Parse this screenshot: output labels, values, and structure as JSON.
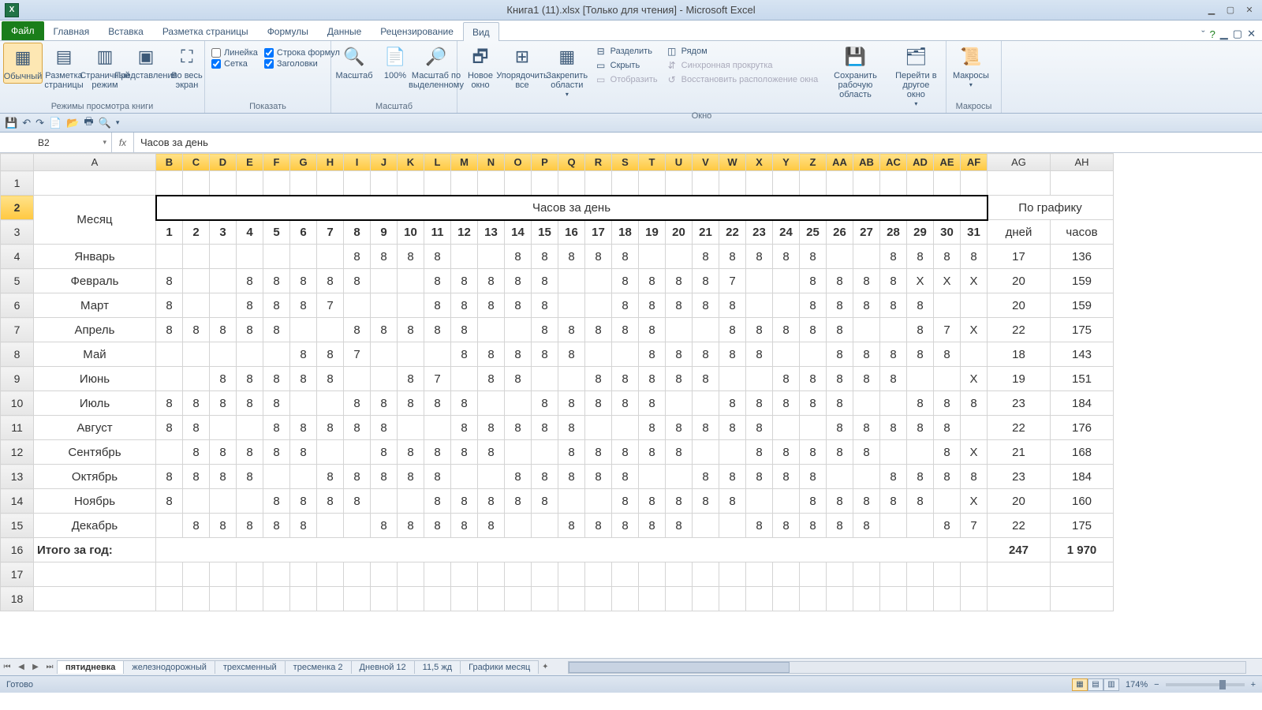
{
  "title": "Книга1 (11).xlsx  [Только для чтения]  -  Microsoft Excel",
  "tabs": {
    "file": "Файл",
    "list": [
      "Главная",
      "Вставка",
      "Разметка страницы",
      "Формулы",
      "Данные",
      "Рецензирование",
      "Вид"
    ],
    "active": 6
  },
  "ribbon": {
    "g1": {
      "label": "Режимы просмотра книги",
      "b": [
        "Обычный",
        "Разметка страницы",
        "Страничный режим",
        "Представления",
        "Во весь экран"
      ]
    },
    "g2": {
      "label": "Показать",
      "c": [
        [
          "Линейка",
          false
        ],
        [
          "Строка формул",
          true
        ],
        [
          "Сетка",
          true
        ],
        [
          "Заголовки",
          true
        ]
      ]
    },
    "g3": {
      "label": "Масштаб",
      "b": [
        "Масштаб",
        "100%",
        "Масштаб по выделенному"
      ]
    },
    "g4": {
      "label": "Окно",
      "b": [
        "Новое окно",
        "Упорядочить все",
        "Закрепить области"
      ],
      "s": [
        "Разделить",
        "Скрыть",
        "Отобразить",
        "Рядом",
        "Синхронная прокрутка",
        "Восстановить расположение окна"
      ],
      "b2": [
        "Сохранить рабочую область",
        "Перейти в другое окно"
      ]
    },
    "g5": {
      "label": "Макросы",
      "b": [
        "Макросы"
      ]
    }
  },
  "namebox": "B2",
  "formula": "Часов за день",
  "cols": [
    "",
    "A",
    "B",
    "C",
    "D",
    "E",
    "F",
    "G",
    "H",
    "I",
    "J",
    "K",
    "L",
    "M",
    "N",
    "O",
    "P",
    "Q",
    "R",
    "S",
    "T",
    "U",
    "V",
    "W",
    "X",
    "Y",
    "Z",
    "AA",
    "AB",
    "AC",
    "AD",
    "AE",
    "AF",
    "AG",
    "AH"
  ],
  "r2": {
    "month": "Месяц",
    "hours": "Часов за день",
    "sched": "По графику"
  },
  "r3": {
    "days": [
      "1",
      "2",
      "3",
      "4",
      "5",
      "6",
      "7",
      "8",
      "9",
      "10",
      "11",
      "12",
      "13",
      "14",
      "15",
      "16",
      "17",
      "18",
      "19",
      "20",
      "21",
      "22",
      "23",
      "24",
      "25",
      "26",
      "27",
      "28",
      "29",
      "30",
      "31"
    ],
    "d": "дней",
    "h": "часов"
  },
  "months": [
    {
      "n": "Январь",
      "v": [
        "",
        "",
        "",
        "",
        "",
        "",
        "",
        "8",
        "8",
        "8",
        "8",
        "",
        "",
        "8",
        "8",
        "8",
        "8",
        "8",
        "",
        "",
        "8",
        "8",
        "8",
        "8",
        "8",
        "",
        "",
        "8",
        "8",
        "8",
        "8"
      ],
      "y": [
        1,
        2,
        3,
        4,
        5,
        6,
        7,
        12,
        13,
        19,
        20,
        26,
        27
      ],
      "d": "17",
      "h": "136"
    },
    {
      "n": "Февраль",
      "v": [
        "8",
        "",
        "",
        "8",
        "8",
        "8",
        "8",
        "8",
        "",
        "",
        "8",
        "8",
        "8",
        "8",
        "8",
        "",
        "",
        "8",
        "8",
        "8",
        "8",
        "7",
        "",
        "",
        "8",
        "8",
        "8",
        "8",
        "Х",
        "Х",
        "Х"
      ],
      "y": [
        2,
        3,
        9,
        10,
        16,
        17,
        23,
        24
      ],
      "g": [
        29,
        30,
        31
      ],
      "d": "20",
      "h": "159"
    },
    {
      "n": "Март",
      "v": [
        "8",
        "",
        "",
        "8",
        "8",
        "8",
        "7",
        "",
        "",
        "",
        "8",
        "8",
        "8",
        "8",
        "8",
        "",
        "",
        "8",
        "8",
        "8",
        "8",
        "8",
        "",
        "",
        "8",
        "8",
        "8",
        "8",
        "8",
        "",
        ""
      ],
      "y": [
        2,
        3,
        8,
        9,
        10,
        16,
        17,
        23,
        24,
        30,
        31
      ],
      "d": "20",
      "h": "159"
    },
    {
      "n": "Апрель",
      "v": [
        "8",
        "8",
        "8",
        "8",
        "8",
        "",
        "",
        "8",
        "8",
        "8",
        "8",
        "8",
        "",
        "",
        "8",
        "8",
        "8",
        "8",
        "8",
        "",
        "",
        "8",
        "8",
        "8",
        "8",
        "8",
        "",
        "",
        "8",
        "7",
        "Х"
      ],
      "y": [
        6,
        7,
        13,
        14,
        20,
        21,
        27,
        28
      ],
      "g": [
        31
      ],
      "d": "22",
      "h": "175"
    },
    {
      "n": "Май",
      "v": [
        "",
        "",
        "",
        "",
        "",
        "8",
        "8",
        "7",
        "",
        "",
        "",
        "8",
        "8",
        "8",
        "8",
        "8",
        "",
        "",
        "8",
        "8",
        "8",
        "8",
        "8",
        "",
        "",
        "8",
        "8",
        "8",
        "8",
        "8",
        ""
      ],
      "y": [
        1,
        2,
        3,
        4,
        5,
        9,
        10,
        11,
        17,
        18,
        24,
        25,
        31
      ],
      "d": "18",
      "h": "143"
    },
    {
      "n": "Июнь",
      "v": [
        "",
        "",
        "8",
        "8",
        "8",
        "8",
        "8",
        "",
        "",
        "8",
        "7",
        "",
        "8",
        "8",
        "",
        "",
        "8",
        "8",
        "8",
        "8",
        "8",
        "",
        "",
        "8",
        "8",
        "8",
        "8",
        "8",
        "",
        "",
        "Х"
      ],
      "y": [
        1,
        2,
        8,
        9,
        12,
        15,
        16,
        22,
        23,
        29,
        30
      ],
      "g": [
        31
      ],
      "d": "19",
      "h": "151"
    },
    {
      "n": "Июль",
      "v": [
        "8",
        "8",
        "8",
        "8",
        "8",
        "",
        "",
        "8",
        "8",
        "8",
        "8",
        "8",
        "",
        "",
        "8",
        "8",
        "8",
        "8",
        "8",
        "",
        "",
        "8",
        "8",
        "8",
        "8",
        "8",
        "",
        "",
        "8",
        "8",
        "8"
      ],
      "y": [
        6,
        7,
        13,
        14,
        20,
        21,
        27,
        28
      ],
      "d": "23",
      "h": "184"
    },
    {
      "n": "Август",
      "v": [
        "8",
        "8",
        "",
        "",
        "8",
        "8",
        "8",
        "8",
        "8",
        "",
        "",
        "8",
        "8",
        "8",
        "8",
        "8",
        "",
        "",
        "8",
        "8",
        "8",
        "8",
        "8",
        "",
        "",
        "8",
        "8",
        "8",
        "8",
        "8",
        ""
      ],
      "y": [
        3,
        4,
        10,
        11,
        17,
        18,
        24,
        25,
        31
      ],
      "d": "22",
      "h": "176"
    },
    {
      "n": "Сентябрь",
      "v": [
        "",
        "8",
        "8",
        "8",
        "8",
        "8",
        "",
        "",
        "8",
        "8",
        "8",
        "8",
        "8",
        "",
        "",
        "8",
        "8",
        "8",
        "8",
        "8",
        "",
        "",
        "8",
        "8",
        "8",
        "8",
        "8",
        "",
        "",
        "8",
        "Х"
      ],
      "y": [
        1,
        7,
        8,
        14,
        15,
        21,
        22,
        28,
        29
      ],
      "g": [
        31
      ],
      "d": "21",
      "h": "168"
    },
    {
      "n": "Октябрь",
      "v": [
        "8",
        "8",
        "8",
        "8",
        "",
        "",
        "8",
        "8",
        "8",
        "8",
        "8",
        "",
        "",
        "8",
        "8",
        "8",
        "8",
        "8",
        "",
        "",
        "8",
        "8",
        "8",
        "8",
        "8",
        "",
        "",
        "8",
        "8",
        "8",
        "8"
      ],
      "y": [
        5,
        6,
        12,
        13,
        19,
        20,
        26,
        27
      ],
      "d": "23",
      "h": "184"
    },
    {
      "n": "Ноябрь",
      "v": [
        "8",
        "",
        "",
        "",
        "8",
        "8",
        "8",
        "8",
        "",
        "",
        "8",
        "8",
        "8",
        "8",
        "8",
        "",
        "",
        "8",
        "8",
        "8",
        "8",
        "8",
        "",
        "",
        "8",
        "8",
        "8",
        "8",
        "8",
        "",
        "Х"
      ],
      "y": [
        2,
        3,
        4,
        9,
        10,
        16,
        17,
        23,
        24,
        30
      ],
      "g": [
        31
      ],
      "d": "20",
      "h": "160"
    },
    {
      "n": "Декабрь",
      "v": [
        "",
        "8",
        "8",
        "8",
        "8",
        "8",
        "",
        "",
        "8",
        "8",
        "8",
        "8",
        "8",
        "",
        "",
        "8",
        "8",
        "8",
        "8",
        "8",
        "",
        "",
        "8",
        "8",
        "8",
        "8",
        "8",
        "",
        "",
        "8",
        "7"
      ],
      "y": [
        1,
        7,
        8,
        14,
        15,
        21,
        22,
        28,
        29
      ],
      "d": "22",
      "h": "175"
    }
  ],
  "total": {
    "label": "Итого за год:",
    "d": "247",
    "h": "1 970"
  },
  "sheets": [
    "пятидневка",
    "железнодорожный",
    "трехсменный",
    "тресменка 2",
    "Дневной 12",
    "11,5 жд",
    "Графики месяц"
  ],
  "sheet_active": 0,
  "status": "Готово",
  "zoom": "174%"
}
